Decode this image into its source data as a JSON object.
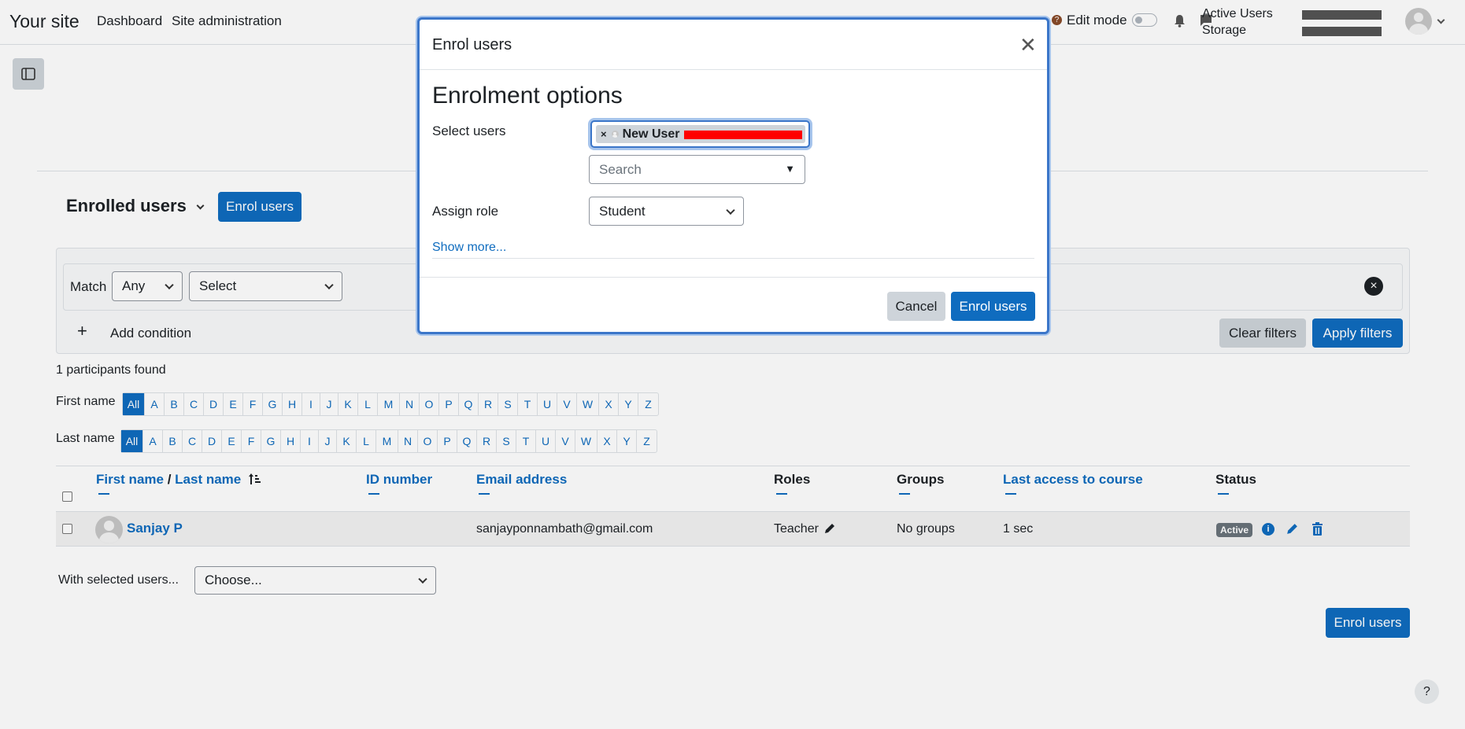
{
  "navbar": {
    "brand": "Your site",
    "links": [
      "Dashboard",
      "Site administration"
    ],
    "edit_mode_label": "Edit mode",
    "active_users_label": "Active Users",
    "storage_label": "Storage"
  },
  "page": {
    "heading": "Enrolled users",
    "enrol_button": "Enrol users",
    "filters": {
      "match_label": "Match",
      "match_value": "Any",
      "select_value": "Select",
      "add_condition": "Add condition",
      "clear_filters": "Clear filters",
      "apply_filters": "Apply filters"
    },
    "participants_found": "1 participants found",
    "first_name_label": "First name",
    "last_name_label": "Last name",
    "initials_all": "All",
    "letters": [
      "A",
      "B",
      "C",
      "D",
      "E",
      "F",
      "G",
      "H",
      "I",
      "J",
      "K",
      "L",
      "M",
      "N",
      "O",
      "P",
      "Q",
      "R",
      "S",
      "T",
      "U",
      "V",
      "W",
      "X",
      "Y",
      "Z"
    ],
    "table": {
      "headers": {
        "first_name": "First name",
        "separator": " / ",
        "last_name": "Last name",
        "id_number": "ID number",
        "email": "Email address",
        "roles": "Roles",
        "groups": "Groups",
        "last_access": "Last access to course",
        "status": "Status"
      },
      "rows": [
        {
          "name": "Sanjay P",
          "email": "sanjayponnambath@gmail.com",
          "role": "Teacher",
          "groups": "No groups",
          "last_access": "1 sec",
          "status": "Active"
        }
      ]
    },
    "with_selected_label": "With selected users...",
    "with_selected_value": "Choose...",
    "bottom_enrol_button": "Enrol users",
    "help": "?"
  },
  "modal": {
    "title": "Enrol users",
    "subtitle": "Enrolment options",
    "select_users_label": "Select users",
    "selected_chip": "New User",
    "chip_remove": "×",
    "search_placeholder": "Search",
    "assign_role_label": "Assign role",
    "assign_role_value": "Student",
    "show_more": "Show more...",
    "cancel": "Cancel",
    "submit": "Enrol users"
  },
  "colors": {
    "primary": "#0f6cbf",
    "redaction": "#ff0000"
  }
}
